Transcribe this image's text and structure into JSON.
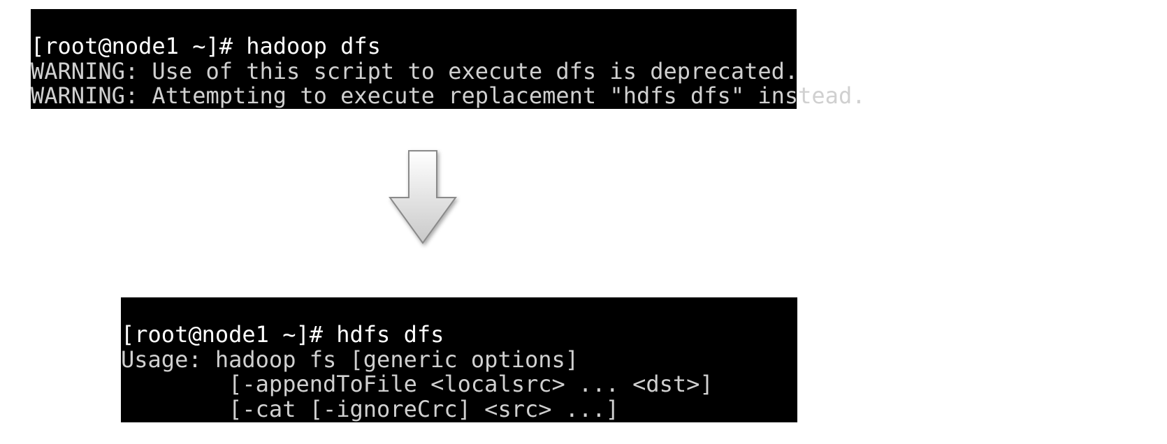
{
  "terminal_top": {
    "prompt": "[root@node1 ~]# ",
    "command": "hadoop dfs",
    "lines": [
      "WARNING: Use of this script to execute dfs is deprecated.",
      "WARNING: Attempting to execute replacement \"hdfs dfs\" instead."
    ]
  },
  "terminal_bottom": {
    "prompt": "[root@node1 ~]# ",
    "command": "hdfs dfs",
    "lines": [
      "Usage: hadoop fs [generic options]",
      "        [-appendToFile <localsrc> ... <dst>]",
      "        [-cat [-ignoreCrc] <src> ...]"
    ]
  },
  "arrow": {
    "name": "down-arrow"
  }
}
